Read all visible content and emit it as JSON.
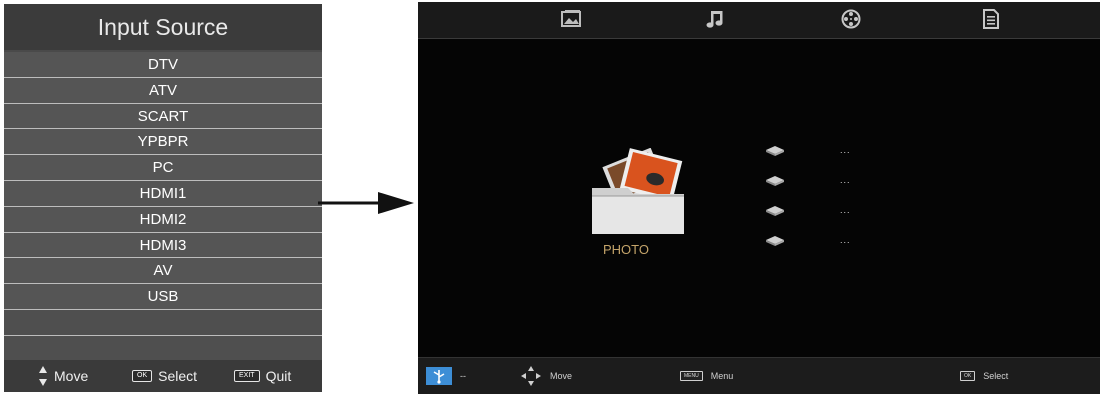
{
  "input_source": {
    "title": "Input Source",
    "items": [
      "DTV",
      "ATV",
      "SCART",
      "YPBPR",
      "PC",
      "HDMI1",
      "HDMI2",
      "HDMI3",
      "AV",
      "USB",
      "",
      ""
    ],
    "footer": {
      "move_label": "Move",
      "ok_key": "OK",
      "select_label": "Select",
      "exit_key": "EXIT",
      "quit_label": "Quit"
    }
  },
  "media": {
    "top_tabs": [
      "photo-tab",
      "music-tab",
      "movie-tab",
      "text-tab"
    ],
    "folder_label": "PHOTO",
    "devices": [
      "...",
      "...",
      "...",
      "..."
    ],
    "bottom_bar": {
      "usb_value": "--",
      "move_label": "Move",
      "menu_key": "MENU",
      "menu_label": "Menu",
      "ok_key": "OK",
      "select_label": "Select"
    }
  },
  "colors": {
    "panel_bg": "#4a4a4a",
    "screen_bg": "#050505",
    "folder_label": "#c4a46a",
    "usb_icon": "#3d8ed6"
  }
}
